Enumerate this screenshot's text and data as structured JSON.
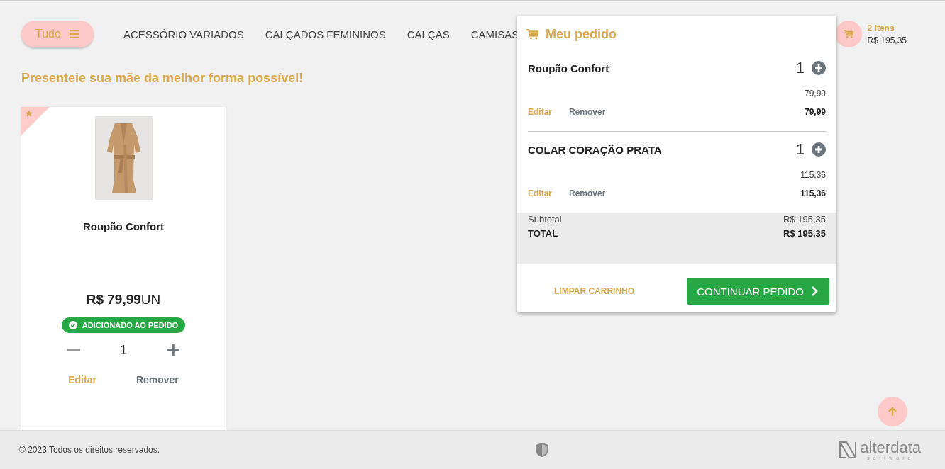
{
  "menu_button": {
    "label": "Tudo"
  },
  "categories": [
    {
      "label": "ACESSÓRIO VARIADOS"
    },
    {
      "label": "CALÇADOS FEMININOS"
    },
    {
      "label": "CALÇAS"
    },
    {
      "label": "CAMISAS"
    }
  ],
  "cart_summary": {
    "count": "2 itens",
    "total": "R$ 195,35"
  },
  "heading": "Presenteie sua mãe da melhor forma possível!",
  "products": [
    {
      "name": "Roupão Confort",
      "price": "R$ 79,99",
      "unit": "UN",
      "featured": true,
      "added": true,
      "added_label": "ADICIONADO AO PEDIDO",
      "quantity": "1",
      "edit": "Editar",
      "remove": "Remover"
    }
  ],
  "order": {
    "title": "Meu pedido",
    "items": [
      {
        "name": "Roupão Confort",
        "quantity": "1",
        "unit_price": "79,99",
        "total": "79,99",
        "edit": "Editar",
        "remove": "Remover"
      },
      {
        "name": "COLAR CORAÇÃO PRATA",
        "quantity": "1",
        "unit_price": "115,36",
        "total": "115,36",
        "edit": "Editar",
        "remove": "Remover"
      }
    ],
    "subtotal_label": "Subtotal",
    "subtotal": "R$ 195,35",
    "total_label": "TOTAL",
    "total": "R$ 195,35",
    "clear_button": "LIMPAR CARRINHO",
    "continue_button": "CONTINUAR PEDIDO"
  },
  "footer": {
    "copyright": "© 2023 Todos os direitos reservados.",
    "logo_name": "alterdata",
    "logo_tagline": "software"
  }
}
